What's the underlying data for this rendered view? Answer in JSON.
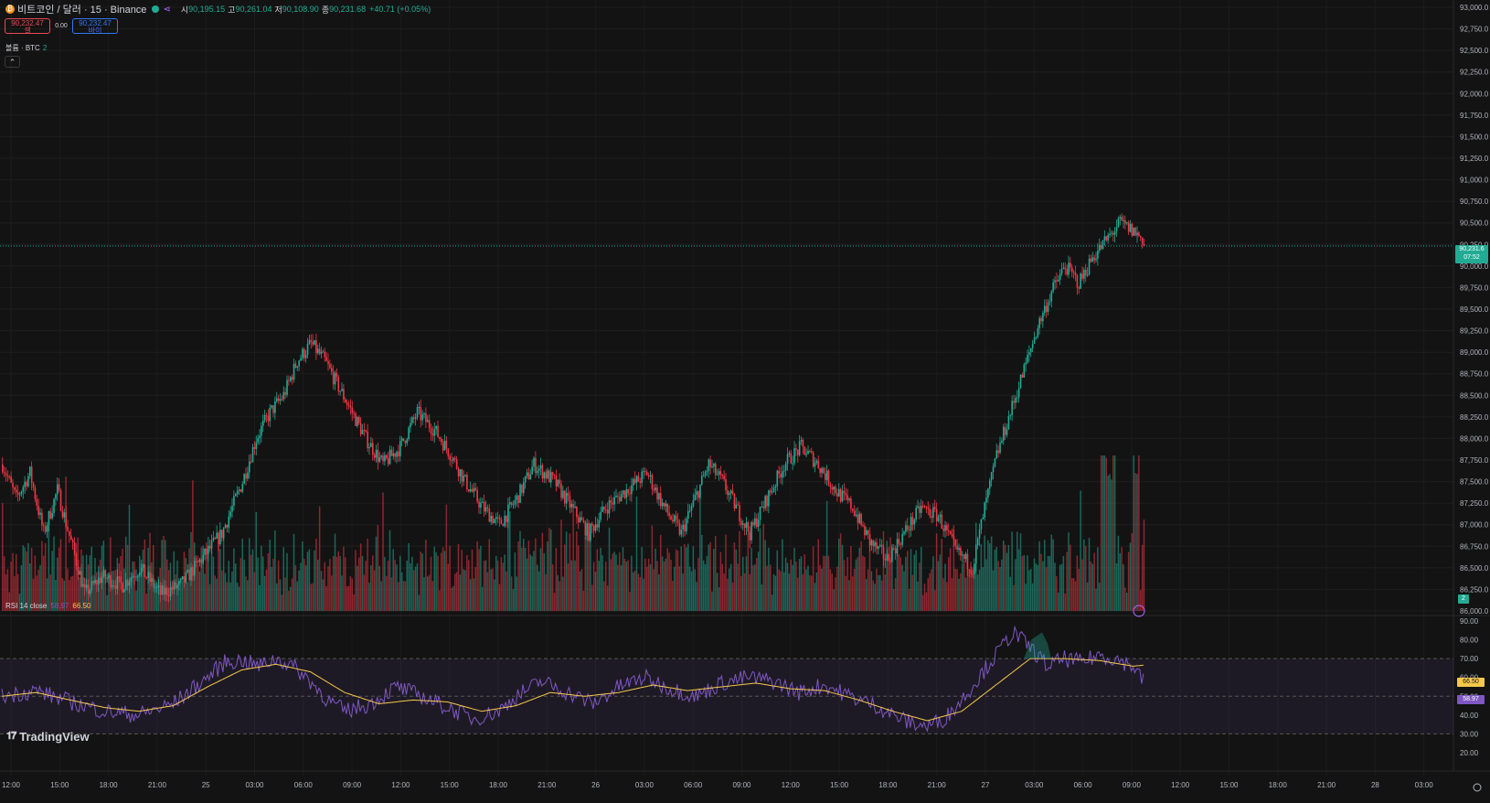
{
  "header": {
    "symbol_icon": "bitcoin-icon",
    "title": "비트코인 / 달러 · 15 · Binance",
    "ohlc": [
      {
        "label": "시",
        "value": "90,195.15"
      },
      {
        "label": "고",
        "value": "90,261.04"
      },
      {
        "label": "저",
        "value": "90,108.90"
      },
      {
        "label": "종",
        "value": "90,231.68"
      }
    ],
    "change": "+40.71 (+0.05%)"
  },
  "trade": {
    "sell_price": "90,232.47",
    "sell_label": "셀",
    "spread": "0.00",
    "buy_price": "90,232.47",
    "buy_label": "바이"
  },
  "volume_legend": {
    "label": "볼륨 · BTC",
    "value": "2"
  },
  "rsi_legend": {
    "label": "RSI 14 close",
    "rsi_value": "58.97",
    "ma_value": "66.50"
  },
  "branding": {
    "logo_text": "TradingView"
  },
  "price_tags": {
    "last_price": "90,231.6",
    "countdown": "07:52",
    "volume": "2",
    "rsi": "58.97",
    "rsi_ma": "66.50"
  },
  "colors": {
    "up": "#22ab94",
    "down": "#f23645",
    "rsi": "#7e57c2",
    "rsi_ma": "#f5c84c",
    "background": "#131313"
  },
  "chart_data": {
    "type": "candlestick",
    "interval": "15",
    "x_ticks": [
      "12:00",
      "15:00",
      "18:00",
      "21:00",
      "25",
      "03:00",
      "06:00",
      "09:00",
      "12:00",
      "15:00",
      "18:00",
      "21:00",
      "26",
      "03:00",
      "06:00",
      "09:00",
      "12:00",
      "15:00",
      "18:00",
      "21:00",
      "27",
      "03:00",
      "06:00",
      "09:00",
      "12:00",
      "15:00",
      "18:00",
      "21:00",
      "28",
      "03:00"
    ],
    "price_axis": {
      "min": 86000,
      "max": 93000,
      "ticks": [
        "93,000.0",
        "92,750.0",
        "92,500.0",
        "92,250.0",
        "92,000.0",
        "91,750.0",
        "91,500.0",
        "91,250.0",
        "91,000.0",
        "90,750.0",
        "90,500.0",
        "90,250.0",
        "90,000.0",
        "89,750.0",
        "89,500.0",
        "89,250.0",
        "89,000.0",
        "88,750.0",
        "88,500.0",
        "88,250.0",
        "88,000.0",
        "87,750.0",
        "87,500.0",
        "87,250.0",
        "87,000.0",
        "86,750.0",
        "86,500.0",
        "86,250.0",
        "86,000.0"
      ]
    },
    "rsi_axis": {
      "min": 20,
      "max": 90,
      "ticks": [
        "90.00",
        "80.00",
        "70.00",
        "60.00",
        "50.00",
        "40.00",
        "30.00",
        "20.00"
      ],
      "band": [
        30,
        70
      ]
    },
    "last_price": 90231.68,
    "price_path": [
      [
        0,
        87700
      ],
      [
        8,
        87300
      ],
      [
        16,
        87600
      ],
      [
        24,
        86900
      ],
      [
        32,
        87400
      ],
      [
        40,
        86800
      ],
      [
        48,
        86200
      ],
      [
        58,
        86400
      ],
      [
        70,
        86300
      ],
      [
        80,
        86500
      ],
      [
        92,
        86200
      ],
      [
        104,
        86300
      ],
      [
        116,
        86600
      ],
      [
        128,
        86900
      ],
      [
        140,
        87500
      ],
      [
        148,
        88000
      ],
      [
        156,
        88300
      ],
      [
        164,
        88500
      ],
      [
        172,
        88900
      ],
      [
        180,
        89100
      ],
      [
        188,
        88900
      ],
      [
        196,
        88600
      ],
      [
        204,
        88300
      ],
      [
        212,
        88000
      ],
      [
        222,
        87700
      ],
      [
        232,
        87900
      ],
      [
        242,
        88300
      ],
      [
        252,
        88100
      ],
      [
        262,
        87800
      ],
      [
        270,
        87500
      ],
      [
        280,
        87200
      ],
      [
        290,
        87000
      ],
      [
        300,
        87300
      ],
      [
        310,
        87700
      ],
      [
        322,
        87500
      ],
      [
        332,
        87200
      ],
      [
        342,
        86900
      ],
      [
        352,
        87200
      ],
      [
        364,
        87400
      ],
      [
        376,
        87600
      ],
      [
        386,
        87200
      ],
      [
        396,
        86900
      ],
      [
        404,
        87300
      ],
      [
        412,
        87700
      ],
      [
        420,
        87500
      ],
      [
        428,
        87200
      ],
      [
        436,
        86900
      ],
      [
        446,
        87300
      ],
      [
        456,
        87700
      ],
      [
        466,
        87900
      ],
      [
        476,
        87700
      ],
      [
        486,
        87400
      ],
      [
        496,
        87200
      ],
      [
        506,
        86800
      ],
      [
        516,
        86600
      ],
      [
        526,
        86900
      ],
      [
        536,
        87200
      ],
      [
        546,
        87100
      ],
      [
        556,
        86700
      ],
      [
        566,
        86500
      ],
      [
        572,
        87100
      ],
      [
        580,
        87800
      ],
      [
        588,
        88300
      ],
      [
        596,
        88800
      ],
      [
        604,
        89300
      ],
      [
        612,
        89700
      ],
      [
        620,
        90000
      ],
      [
        628,
        89800
      ],
      [
        636,
        90100
      ],
      [
        644,
        90300
      ],
      [
        652,
        90500
      ],
      [
        660,
        90400
      ],
      [
        666,
        90300
      ]
    ],
    "rsi_path": [
      [
        0,
        50
      ],
      [
        20,
        53
      ],
      [
        40,
        47
      ],
      [
        60,
        42
      ],
      [
        80,
        40
      ],
      [
        100,
        46
      ],
      [
        120,
        60
      ],
      [
        130,
        68
      ],
      [
        140,
        69
      ],
      [
        150,
        66
      ],
      [
        160,
        70
      ],
      [
        170,
        66
      ],
      [
        180,
        58
      ],
      [
        190,
        48
      ],
      [
        200,
        42
      ],
      [
        215,
        46
      ],
      [
        230,
        55
      ],
      [
        245,
        50
      ],
      [
        260,
        44
      ],
      [
        275,
        38
      ],
      [
        290,
        42
      ],
      [
        300,
        50
      ],
      [
        315,
        58
      ],
      [
        330,
        52
      ],
      [
        345,
        46
      ],
      [
        360,
        55
      ],
      [
        375,
        60
      ],
      [
        390,
        54
      ],
      [
        405,
        50
      ],
      [
        420,
        57
      ],
      [
        435,
        60
      ],
      [
        450,
        58
      ],
      [
        465,
        52
      ],
      [
        480,
        56
      ],
      [
        495,
        50
      ],
      [
        510,
        45
      ],
      [
        520,
        40
      ],
      [
        530,
        36
      ],
      [
        540,
        34
      ],
      [
        550,
        38
      ],
      [
        560,
        48
      ],
      [
        570,
        60
      ],
      [
        580,
        72
      ],
      [
        590,
        84
      ],
      [
        600,
        76
      ],
      [
        610,
        66
      ],
      [
        620,
        70
      ],
      [
        630,
        68
      ],
      [
        640,
        72
      ],
      [
        650,
        70
      ],
      [
        660,
        66
      ],
      [
        666,
        58
      ]
    ],
    "rsi_ma_path": [
      [
        0,
        50
      ],
      [
        20,
        52
      ],
      [
        40,
        48
      ],
      [
        60,
        44
      ],
      [
        80,
        42
      ],
      [
        100,
        45
      ],
      [
        120,
        55
      ],
      [
        140,
        64
      ],
      [
        160,
        67
      ],
      [
        180,
        63
      ],
      [
        200,
        52
      ],
      [
        220,
        46
      ],
      [
        240,
        48
      ],
      [
        260,
        47
      ],
      [
        280,
        42
      ],
      [
        300,
        45
      ],
      [
        320,
        52
      ],
      [
        340,
        50
      ],
      [
        360,
        52
      ],
      [
        380,
        56
      ],
      [
        400,
        53
      ],
      [
        420,
        55
      ],
      [
        440,
        57
      ],
      [
        460,
        54
      ],
      [
        480,
        53
      ],
      [
        500,
        48
      ],
      [
        520,
        42
      ],
      [
        540,
        37
      ],
      [
        560,
        42
      ],
      [
        580,
        56
      ],
      [
        600,
        70
      ],
      [
        620,
        70
      ],
      [
        640,
        69
      ],
      [
        660,
        66
      ],
      [
        666,
        66.5
      ]
    ],
    "volume_scale_max": 2
  }
}
